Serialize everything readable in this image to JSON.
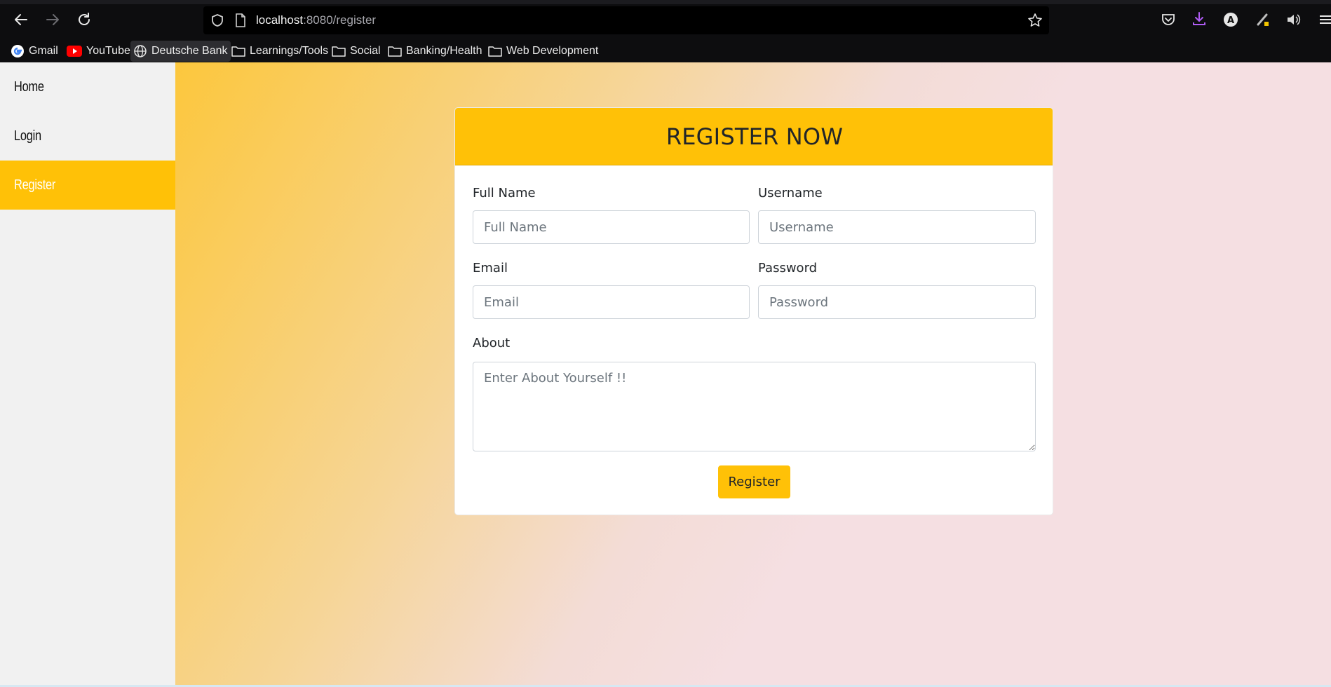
{
  "browser": {
    "url_host": "localhost",
    "url_rest": ":8080/register",
    "bookmarks": [
      {
        "label": "Gmail",
        "icon": "google-icon"
      },
      {
        "label": "YouTube",
        "icon": "youtube-icon"
      },
      {
        "label": "Deutsche Bank",
        "icon": "globe-icon"
      },
      {
        "label": "Learnings/Tools",
        "icon": "folder-icon"
      },
      {
        "label": "Social",
        "icon": "folder-icon"
      },
      {
        "label": "Banking/Health",
        "icon": "folder-icon"
      },
      {
        "label": "Web Development",
        "icon": "folder-icon"
      }
    ]
  },
  "sidebar": {
    "items": [
      {
        "label": "Home"
      },
      {
        "label": "Login"
      },
      {
        "label": "Register",
        "active": true
      }
    ]
  },
  "form": {
    "title": "REGISTER NOW",
    "full_name_label": "Full Name",
    "full_name_placeholder": "Full Name",
    "username_label": "Username",
    "username_placeholder": "Username",
    "email_label": "Email",
    "email_placeholder": "Email",
    "password_label": "Password",
    "password_placeholder": "Password",
    "about_label": "About",
    "about_placeholder": "Enter About Yourself !!",
    "submit_label": "Register"
  },
  "colors": {
    "accent": "#ffc107",
    "sidebar_bg": "#f1f1f1"
  }
}
